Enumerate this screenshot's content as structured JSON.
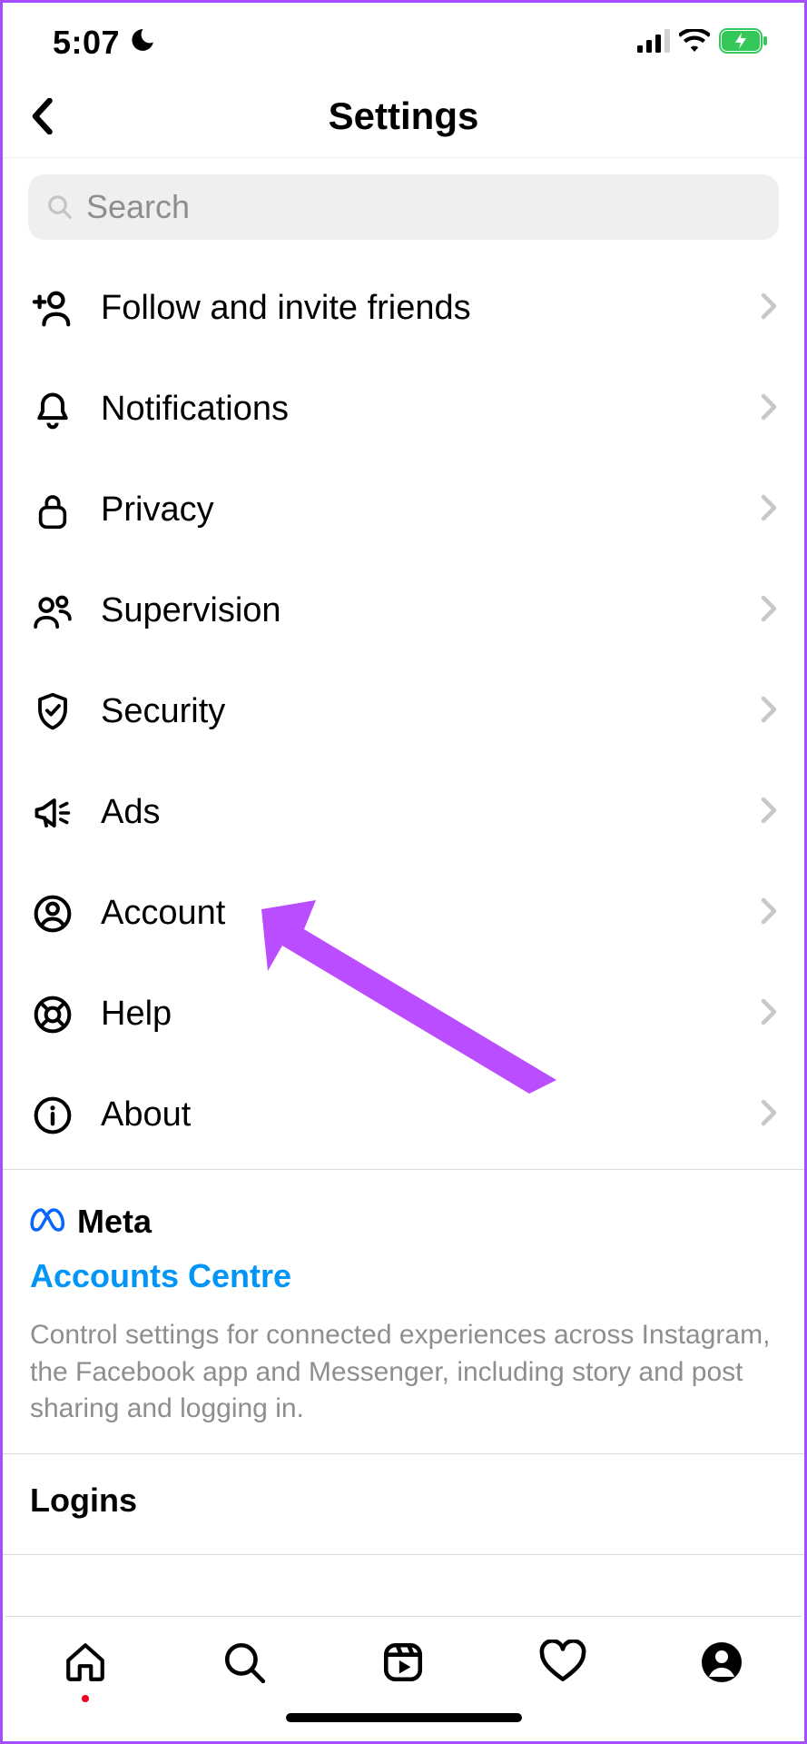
{
  "status": {
    "time": "5:07"
  },
  "header": {
    "title": "Settings"
  },
  "search": {
    "placeholder": "Search"
  },
  "menu": {
    "items": [
      {
        "id": "follow-invite",
        "label": "Follow and invite friends"
      },
      {
        "id": "notifications",
        "label": "Notifications"
      },
      {
        "id": "privacy",
        "label": "Privacy"
      },
      {
        "id": "supervision",
        "label": "Supervision"
      },
      {
        "id": "security",
        "label": "Security"
      },
      {
        "id": "ads",
        "label": "Ads"
      },
      {
        "id": "account",
        "label": "Account"
      },
      {
        "id": "help",
        "label": "Help"
      },
      {
        "id": "about",
        "label": "About"
      }
    ]
  },
  "meta": {
    "brand": "Meta",
    "link": "Accounts Centre",
    "description": "Control settings for connected experiences across Instagram, the Facebook app and Messenger, including story and post sharing and logging in."
  },
  "logins": {
    "title": "Logins"
  },
  "annotation": {
    "target": "account"
  }
}
